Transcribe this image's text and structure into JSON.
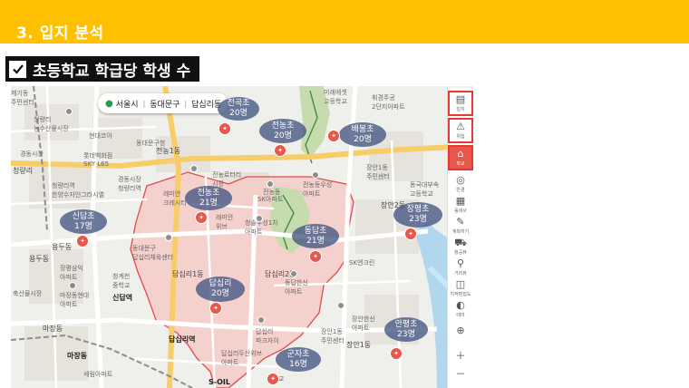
{
  "header": {
    "title": "3. 입지 분석"
  },
  "subtitle": {
    "text": "초등학교 학급당 학생 수"
  },
  "location_bar": {
    "city": "서울시",
    "district": "동대문구",
    "dong": "답십리동"
  },
  "schools": [
    {
      "name": "전곡초",
      "students": "20명"
    },
    {
      "name": "전농초",
      "students": "20명"
    },
    {
      "name": "배봉초",
      "students": "20명"
    },
    {
      "name": "전농초",
      "students": "21명"
    },
    {
      "name": "신답초",
      "students": "17명"
    },
    {
      "name": "동답초",
      "students": "21명"
    },
    {
      "name": "장평초",
      "students": "23명"
    },
    {
      "name": "답십리",
      "students": "20명"
    },
    {
      "name": "안평초",
      "students": "23명"
    },
    {
      "name": "군자초",
      "students": "16명"
    }
  ],
  "map_labels": {
    "l1": "제기동\n주민센터",
    "l2": "청량리\n농수산물시장",
    "l3": "현대코아",
    "l4": "경동시장",
    "l5": "롯데백화점\nSKY L65",
    "l6": "청량리",
    "l7": "경동시장\n청량리역",
    "l8": "청량리역\n한양수자인그라시엘",
    "l9": "동대문구청",
    "l10": "전농1동",
    "l11": "전농로터리\n시장",
    "l12": "레미안\n크레시티",
    "l13": "전농동",
    "l14": "SK아파트",
    "l15": "전농동우성\n아파트",
    "l16": "미래에셋\n고등학교",
    "l17": "휘경주공\n2단지아파트",
    "l18": "장안1동\n주민센터",
    "l19": "동국대부속\n고등학교",
    "l20": "장안2동",
    "l21": "래미안\n위브",
    "l22": "청솔우성1차\n아파트",
    "l23": "동대문구\n답십리체육센터",
    "l24": "답십리1동",
    "l25": "답십리2동",
    "l26": "동답한신\n아파트",
    "l27": "SK엔크린",
    "l28": "용두동",
    "l29": "청계천\n중학교",
    "l30": "신답역",
    "l31": "장평삼익\n아파트",
    "l32": "마장동현대\n아파트",
    "l33": "용두동",
    "l34": "마장동",
    "l35": "답십리역",
    "l36": "답십리\n파크자이",
    "l37": "답십리두산위브\n아파트",
    "l38": "장안한신\n아파트",
    "l39": "장안1동\n주민센터",
    "l40": "장안1동",
    "l41": "세림아파트",
    "l42": "S-OIL",
    "l43": "군자교",
    "l44": "마장동",
    "l45": "축산물시장"
  },
  "tools": [
    {
      "icon": "notice-icon",
      "label": "일지"
    },
    {
      "icon": "warning-icon",
      "label": "위험"
    },
    {
      "icon": "school-icon",
      "label": "학교"
    },
    {
      "icon": "target-icon",
      "label": "반경"
    },
    {
      "icon": "map-icon",
      "label": "동네사"
    },
    {
      "icon": "pen-icon",
      "label": "계획하기"
    },
    {
      "icon": "car-icon",
      "label": "항공뷰"
    },
    {
      "icon": "pin-icon",
      "label": "거리뷰"
    },
    {
      "icon": "share-icon",
      "label": "지적편집도"
    },
    {
      "icon": "theme-icon",
      "label": "테마"
    }
  ],
  "colors": {
    "header": "#FFC000",
    "subtitle_bg": "#111111",
    "school_bubble": "#435482",
    "school_marker": "#e8574b",
    "district_fill": "#f6c9c6",
    "district_border": "#e04a4a",
    "highlight": "#e53935"
  }
}
